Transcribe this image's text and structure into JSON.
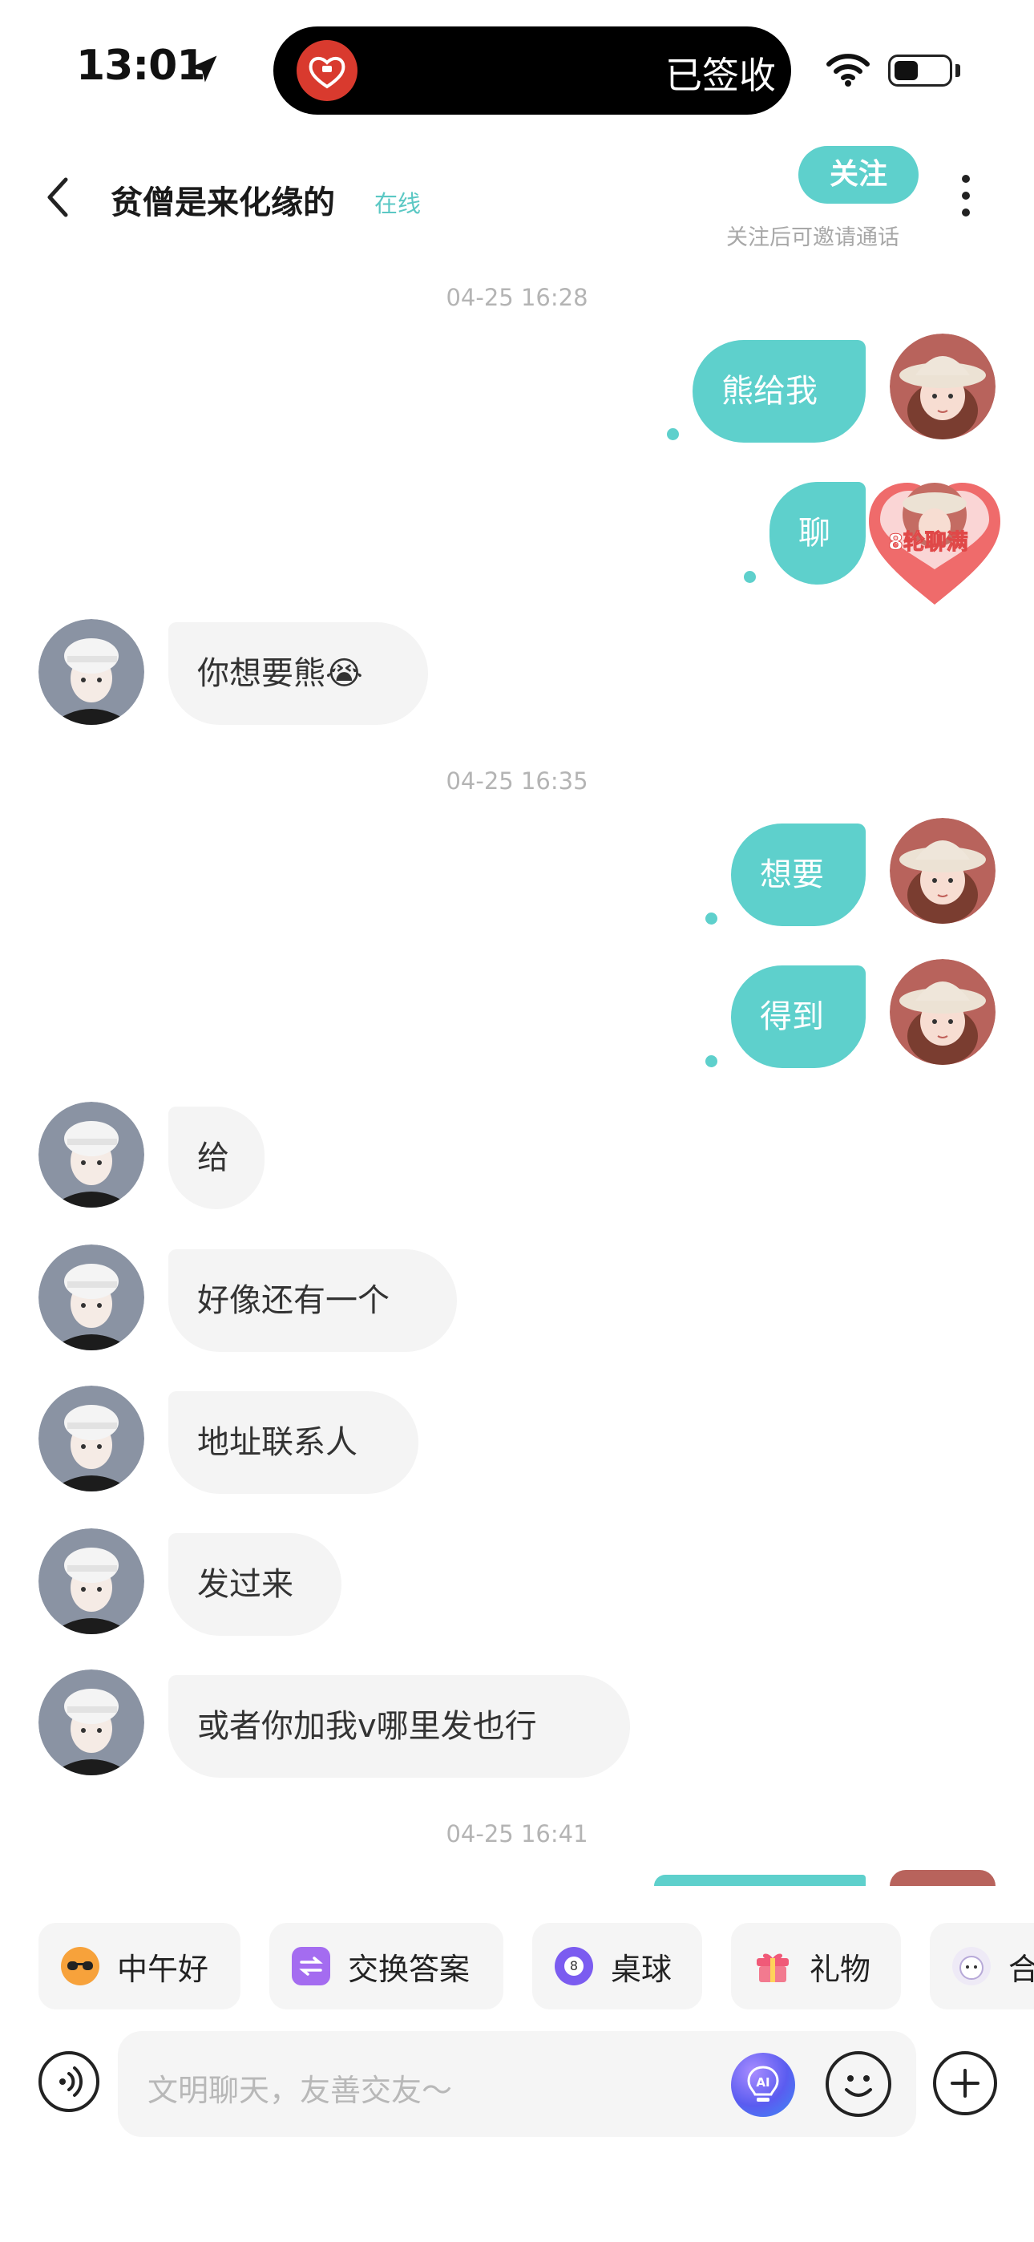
{
  "status_bar": {
    "time": "13:01",
    "island_text": "已签收",
    "battery_level": 0.45
  },
  "header": {
    "title": "贫僧是来化缘的",
    "online_status": "在线",
    "follow_label": "关注",
    "follow_hint": "关注后可邀请通话"
  },
  "messages": [
    {
      "type": "timestamp",
      "text": "04-25 16:28"
    },
    {
      "type": "sent",
      "text": "熊给我"
    },
    {
      "type": "sent",
      "text": "聊",
      "badge": "8轮聊满"
    },
    {
      "type": "received",
      "text": "你想要熊😭"
    },
    {
      "type": "timestamp",
      "text": "04-25 16:35"
    },
    {
      "type": "sent",
      "text": "想要"
    },
    {
      "type": "sent",
      "text": "得到"
    },
    {
      "type": "received",
      "text": "给"
    },
    {
      "type": "received",
      "text": "好像还有一个"
    },
    {
      "type": "received",
      "text": "地址联系人"
    },
    {
      "type": "received",
      "text": "发过来"
    },
    {
      "type": "received",
      "text": "或者你加我v哪里发也行"
    },
    {
      "type": "timestamp",
      "text": "04-25 16:41"
    }
  ],
  "quick_actions": [
    {
      "label": "中午好",
      "icon": "sunglasses-sun-icon"
    },
    {
      "label": "交换答案",
      "icon": "exchange-chat-icon"
    },
    {
      "label": "桌球",
      "icon": "billiard-ball-icon"
    },
    {
      "label": "礼物",
      "icon": "gift-icon"
    },
    {
      "label": "合",
      "icon": "mascot-icon"
    }
  ],
  "input": {
    "placeholder": "文明聊天，友善交友～"
  },
  "colors": {
    "accent": "#5ed0cc",
    "bubble_received": "#f4f4f4",
    "heart": "#ef6b6b"
  }
}
